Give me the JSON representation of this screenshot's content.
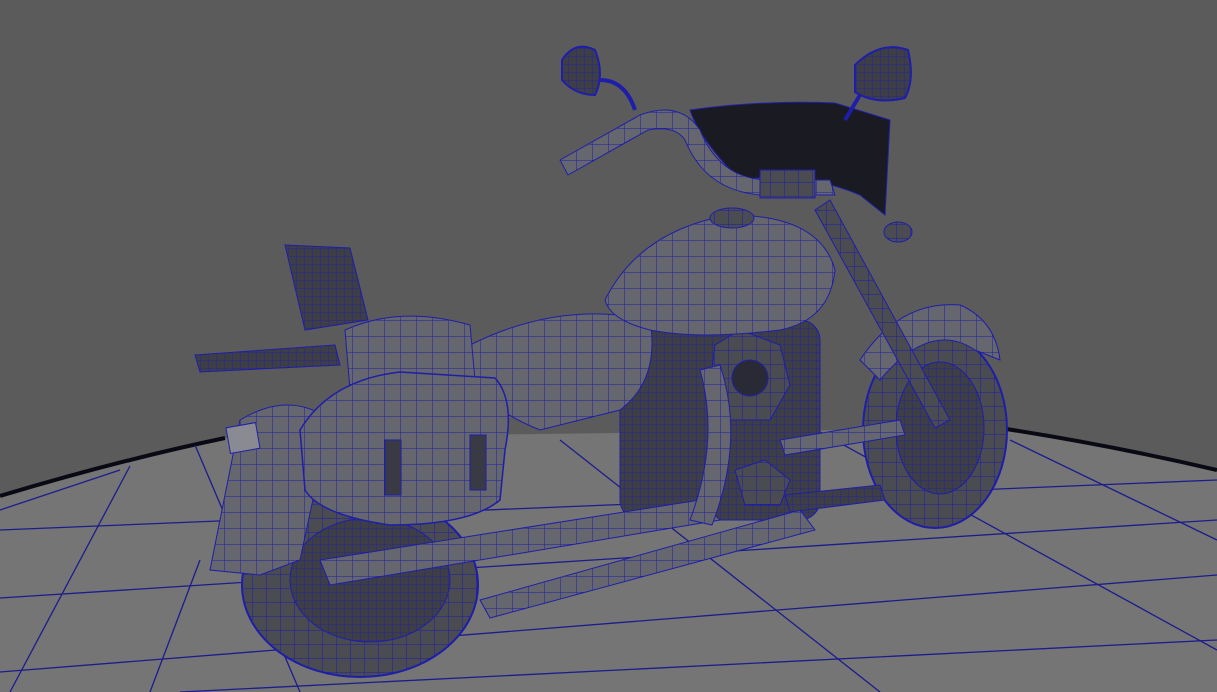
{
  "viewport": {
    "background_color": "#5b5b5b",
    "floor_color": "#757575",
    "grid_line_color": "#1c1c8c",
    "horizon_edge_color": "#0a0a14",
    "mesh_fill_color": "#4b4b52",
    "mesh_fill_light": "#6a6a72",
    "wire_color": "#1e1eaa",
    "dark_part_color": "#1a1a22"
  }
}
